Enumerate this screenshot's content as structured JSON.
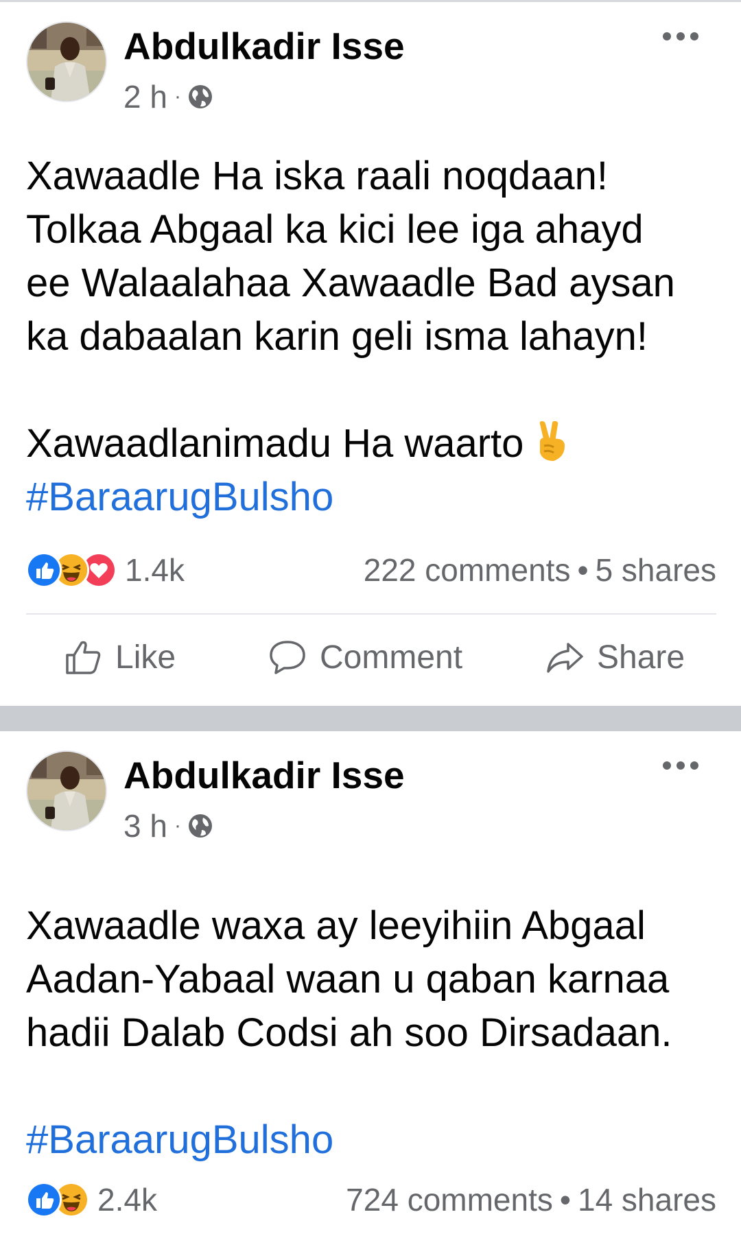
{
  "posts": [
    {
      "author": "Abdulkadir Isse",
      "time": "2 h",
      "audience_icon": "globe-icon",
      "text_lines": [
        "Xawaadle Ha iska raali noqdaan!",
        "Tolkaa Abgaal ka kici lee iga ahayd",
        "ee Walaalahaa Xawaadle Bad aysan",
        "ka dabaalan karin geli isma lahayn!"
      ],
      "text_line_2": "Xawaadlanimadu Ha waarto",
      "emoji": "victory-hand-icon",
      "hashtag": "#BaraarugBulsho",
      "reactions": [
        "like-icon",
        "haha-icon",
        "love-icon"
      ],
      "reaction_count": "1.4k",
      "comments": "222 comments",
      "shares": "5 shares",
      "actions": {
        "like": "Like",
        "comment": "Comment",
        "share": "Share"
      }
    },
    {
      "author": "Abdulkadir Isse",
      "time": "3 h",
      "audience_icon": "globe-icon",
      "text_lines": [
        "Xawaadle waxa ay leeyihiin Abgaal",
        "Aadan-Yabaal waan u qaban karnaa",
        "hadii Dalab Codsi ah soo Dirsadaan."
      ],
      "hashtag": "#BaraarugBulsho",
      "reactions": [
        "like-icon",
        "haha-icon"
      ],
      "reaction_count": "2.4k",
      "comments": "724 comments",
      "shares": "14 shares"
    }
  ],
  "colors": {
    "link": "#216fdb",
    "secondary_text": "#65676b",
    "separator": "#c9ccd1",
    "like_blue": "#1877f2",
    "love_red": "#f33e58",
    "haha_yellow": "#f7b125"
  }
}
